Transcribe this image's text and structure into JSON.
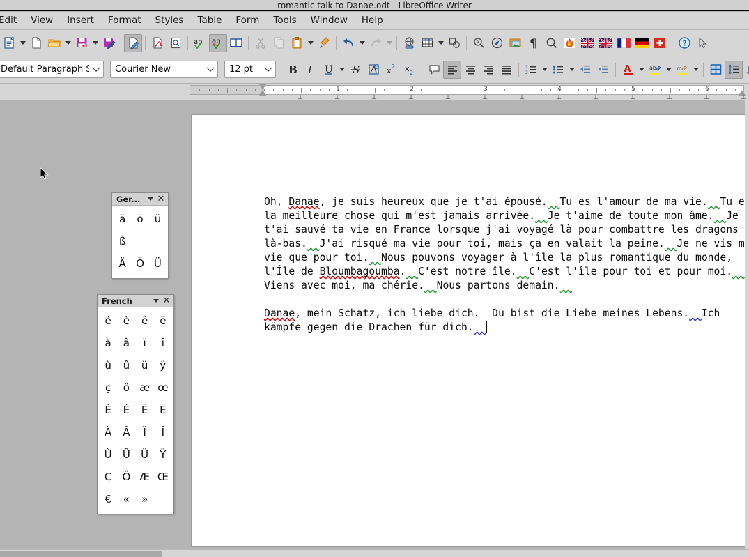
{
  "window": {
    "title": "romantic talk to Danae.odt - LibreOffice Writer"
  },
  "menubar": {
    "items": [
      {
        "label": "Edit"
      },
      {
        "label": "View"
      },
      {
        "label": "Insert"
      },
      {
        "label": "Format"
      },
      {
        "label": "Styles"
      },
      {
        "label": "Table"
      },
      {
        "label": "Form"
      },
      {
        "label": "Tools"
      },
      {
        "label": "Window"
      },
      {
        "label": "Help"
      }
    ]
  },
  "standard_toolbar": {
    "buttons": [
      {
        "name": "new-document-icon",
        "tooltip": "New"
      },
      {
        "name": "new-blank-icon",
        "tooltip": "New Document"
      },
      {
        "name": "open-folder-icon",
        "tooltip": "Open"
      },
      {
        "name": "save-icon",
        "tooltip": "Save"
      },
      {
        "name": "save-as-icon",
        "tooltip": "Save As"
      },
      {
        "name": "edit-mode-icon",
        "tooltip": "Edit Mode"
      },
      {
        "name": "export-pdf-icon",
        "tooltip": "Export as PDF"
      },
      {
        "name": "print-preview-icon",
        "tooltip": "Print Preview"
      },
      {
        "name": "spelling-icon",
        "tooltip": "Check Spelling"
      },
      {
        "name": "auto-spellcheck-icon",
        "tooltip": "Automatic Spell Checking"
      },
      {
        "name": "book-dictionary-icon",
        "tooltip": "Thesaurus"
      },
      {
        "name": "cut-icon",
        "tooltip": "Cut"
      },
      {
        "name": "copy-icon",
        "tooltip": "Copy"
      },
      {
        "name": "paste-icon",
        "tooltip": "Paste"
      },
      {
        "name": "clone-formatting-icon",
        "tooltip": "Clone Formatting"
      },
      {
        "name": "undo-icon",
        "tooltip": "Undo"
      },
      {
        "name": "redo-icon",
        "tooltip": "Redo"
      },
      {
        "name": "hyperlink-icon",
        "tooltip": "Insert Hyperlink"
      },
      {
        "name": "insert-table-icon",
        "tooltip": "Insert Table"
      },
      {
        "name": "insert-shape-icon",
        "tooltip": "Insert Shape"
      },
      {
        "name": "find-replace-icon",
        "tooltip": "Find and Replace"
      },
      {
        "name": "special-character-icon",
        "tooltip": "Insert Special Character"
      },
      {
        "name": "insert-image-icon",
        "tooltip": "Insert Image"
      },
      {
        "name": "formatting-marks-icon",
        "tooltip": "Formatting Marks"
      },
      {
        "name": "find-icon",
        "tooltip": "Find"
      },
      {
        "name": "flame-icon",
        "tooltip": "Macro"
      },
      {
        "name": "flag-uk-icon",
        "tooltip": "English (UK)"
      },
      {
        "name": "flag-uk-2-icon",
        "tooltip": "English"
      },
      {
        "name": "flag-france-icon",
        "tooltip": "French"
      },
      {
        "name": "flag-germany-icon",
        "tooltip": "German"
      },
      {
        "name": "flag-switzerland-icon",
        "tooltip": "Swiss"
      },
      {
        "name": "help-icon",
        "tooltip": "Help"
      },
      {
        "name": "pointer-icon",
        "tooltip": "Select"
      }
    ]
  },
  "formatting_toolbar": {
    "paragraph_style": "Default Paragraph Styl",
    "font_name": "Courier New",
    "font_size": "12 pt",
    "buttons": [
      {
        "name": "bold-button",
        "label": "B"
      },
      {
        "name": "italic-button",
        "label": "I"
      },
      {
        "name": "underline-button",
        "label": "U"
      },
      {
        "name": "strikethrough-button",
        "label": "S"
      },
      {
        "name": "character-highlight-button",
        "label": ""
      },
      {
        "name": "superscript-button",
        "label": "x2"
      },
      {
        "name": "subscript-button",
        "label": "x2"
      },
      {
        "name": "insert-comment-button",
        "label": ""
      },
      {
        "name": "align-left-button",
        "label": ""
      },
      {
        "name": "align-center-button",
        "label": ""
      },
      {
        "name": "align-right-button",
        "label": ""
      },
      {
        "name": "align-justify-button",
        "label": ""
      },
      {
        "name": "ordered-list-button",
        "label": ""
      },
      {
        "name": "unordered-list-button",
        "label": ""
      },
      {
        "name": "decrease-indent-button",
        "label": ""
      },
      {
        "name": "increase-indent-button",
        "label": ""
      },
      {
        "name": "font-color-button",
        "label": "A"
      },
      {
        "name": "highlight-color-button",
        "label": ""
      },
      {
        "name": "character-background-button",
        "label": ""
      },
      {
        "name": "table-properties-button",
        "label": ""
      },
      {
        "name": "line-spacing-button",
        "label": ""
      },
      {
        "name": "paragraph-spacing-button",
        "label": ""
      }
    ]
  },
  "ruler": {
    "unit": "inch",
    "numbers": [
      "1",
      "2",
      "3",
      "4",
      "5",
      "6"
    ],
    "left_indent_inch": 1.0,
    "right_indent_inch": 7.0
  },
  "document": {
    "paragraphs": [
      {
        "id": "french-paragraph",
        "runs": [
          {
            "text": "Oh, ",
            "mark": "none"
          },
          {
            "text": "Danae",
            "mark": "spelling"
          },
          {
            "text": ", je suis heureux que je t'ai épousé.",
            "mark": "none"
          },
          {
            "text": "  ",
            "mark": "grammar"
          },
          {
            "text": "Tu es l'amour de ma vie.",
            "mark": "none"
          },
          {
            "text": "  ",
            "mark": "grammar"
          },
          {
            "text": "Tu es la meilleure chose qui m'est jamais arrivée.",
            "mark": "none"
          },
          {
            "text": "  ",
            "mark": "grammar"
          },
          {
            "text": "Je t'aime de toute mon âme.",
            "mark": "none"
          },
          {
            "text": "  ",
            "mark": "grammar"
          },
          {
            "text": "Je t'ai sauvé ta vie en France lorsque j'ai voyagé là pour combattre les dragons là-bas.",
            "mark": "none"
          },
          {
            "text": "  ",
            "mark": "grammar"
          },
          {
            "text": "J'ai risqué ma vie pour toi, mais ça en valait la peine.",
            "mark": "none"
          },
          {
            "text": "  ",
            "mark": "grammar"
          },
          {
            "text": "Je ne vis ma vie que pour toi.",
            "mark": "none"
          },
          {
            "text": "  ",
            "mark": "grammar"
          },
          {
            "text": "Nous pouvons voyager à l'île la plus romantique du monde, l'Île de ",
            "mark": "none"
          },
          {
            "text": "Bloumbagoumba",
            "mark": "spelling"
          },
          {
            "text": ".",
            "mark": "none"
          },
          {
            "text": "  ",
            "mark": "grammar"
          },
          {
            "text": "C'est notre île.",
            "mark": "none"
          },
          {
            "text": "  ",
            "mark": "grammar"
          },
          {
            "text": "C'est l'île pour toi et pour moi.",
            "mark": "none"
          },
          {
            "text": "  ",
            "mark": "grammar"
          },
          {
            "text": "Viens avec moi, ma chérie.",
            "mark": "none"
          },
          {
            "text": "  ",
            "mark": "grammar"
          },
          {
            "text": "Nous partons demain.",
            "mark": "none"
          },
          {
            "text": "  ",
            "mark": "grammar"
          }
        ]
      },
      {
        "id": "german-paragraph",
        "runs": [
          {
            "text": "Danae",
            "mark": "spelling"
          },
          {
            "text": ", mein Schatz, ich liebe dich.  Du bist die Liebe meines Lebens.",
            "mark": "none"
          },
          {
            "text": "  ",
            "mark": "grammar-de"
          },
          {
            "text": "Ich kämpfe gegen die Drachen für dich.",
            "mark": "none"
          },
          {
            "text": "  ",
            "mark": "grammar-de"
          }
        ]
      }
    ]
  },
  "german_toolbar": {
    "title": "Ger...",
    "rows": [
      [
        "ä",
        "ö",
        "ü"
      ],
      [
        "ß"
      ],
      [
        "Ä",
        "Ö",
        "Ü"
      ]
    ]
  },
  "french_toolbar": {
    "title": "French",
    "rows": [
      [
        "é",
        "è",
        "ê",
        "ë"
      ],
      [
        "à",
        "â",
        "ï",
        "î"
      ],
      [
        "ù",
        "û",
        "ü",
        "ÿ"
      ],
      [
        "ç",
        "ô",
        "æ",
        "œ"
      ],
      [
        "É",
        "È",
        "Ê",
        "Ë"
      ],
      [
        "À",
        "Â",
        "Ï",
        "Î"
      ],
      [
        "Ù",
        "Û",
        "Ü",
        "Ÿ"
      ],
      [
        "Ç",
        "Ô",
        "Æ",
        "Œ"
      ],
      [
        "€",
        "«",
        "»"
      ]
    ]
  },
  "colors": {
    "chrome": "#d6d6d6",
    "workspace": "#b4b4b4",
    "page": "#ffffff",
    "spelling_error": "#d00000",
    "grammar_error": "#1f9a2e",
    "grammar_error_de": "#2b3fd0",
    "accent": "#2a6099"
  }
}
